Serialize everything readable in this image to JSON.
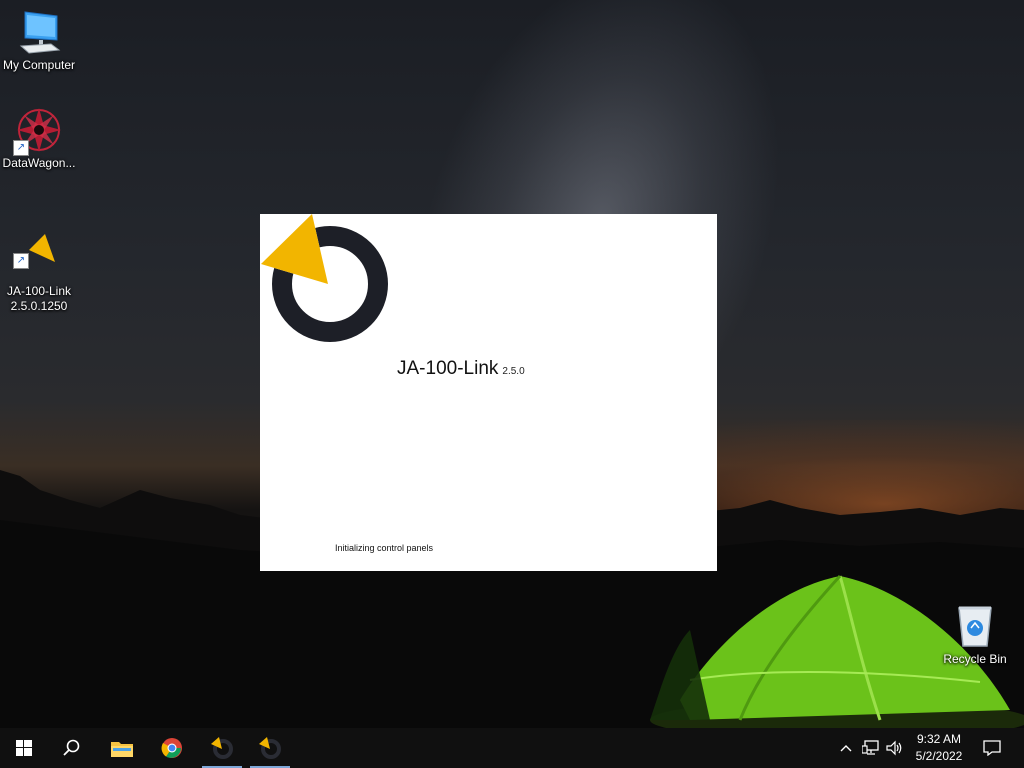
{
  "desktop": {
    "icons": [
      {
        "label": "My Computer",
        "icon": "monitor-icon"
      },
      {
        "label": "DataWagon...",
        "icon": "datawagon-icon"
      },
      {
        "label": "JA-100-Link\n2.5.0.1250",
        "icon": "ja100-logo-icon"
      },
      {
        "label": "Recycle Bin",
        "icon": "recycle-bin-icon"
      }
    ]
  },
  "splash": {
    "app_name": "JA-100-Link",
    "version": "2.5.0",
    "status": "Initializing control panels",
    "logo_colors": {
      "ring": "#1d1f27",
      "wedge": "#f2b500"
    }
  },
  "taskbar": {
    "start": "windows-start-icon",
    "search": "search-icon",
    "apps": [
      "file-explorer-icon",
      "chrome-icon",
      "ja100-taskbar-icon",
      "ja100-taskbar-icon"
    ],
    "tray": [
      "chevron-up-icon",
      "network-icon",
      "volume-icon"
    ],
    "time": "9:32 AM",
    "date": "5/2/2022",
    "notifications": "action-center-icon",
    "accent": "#7ea7d8"
  }
}
